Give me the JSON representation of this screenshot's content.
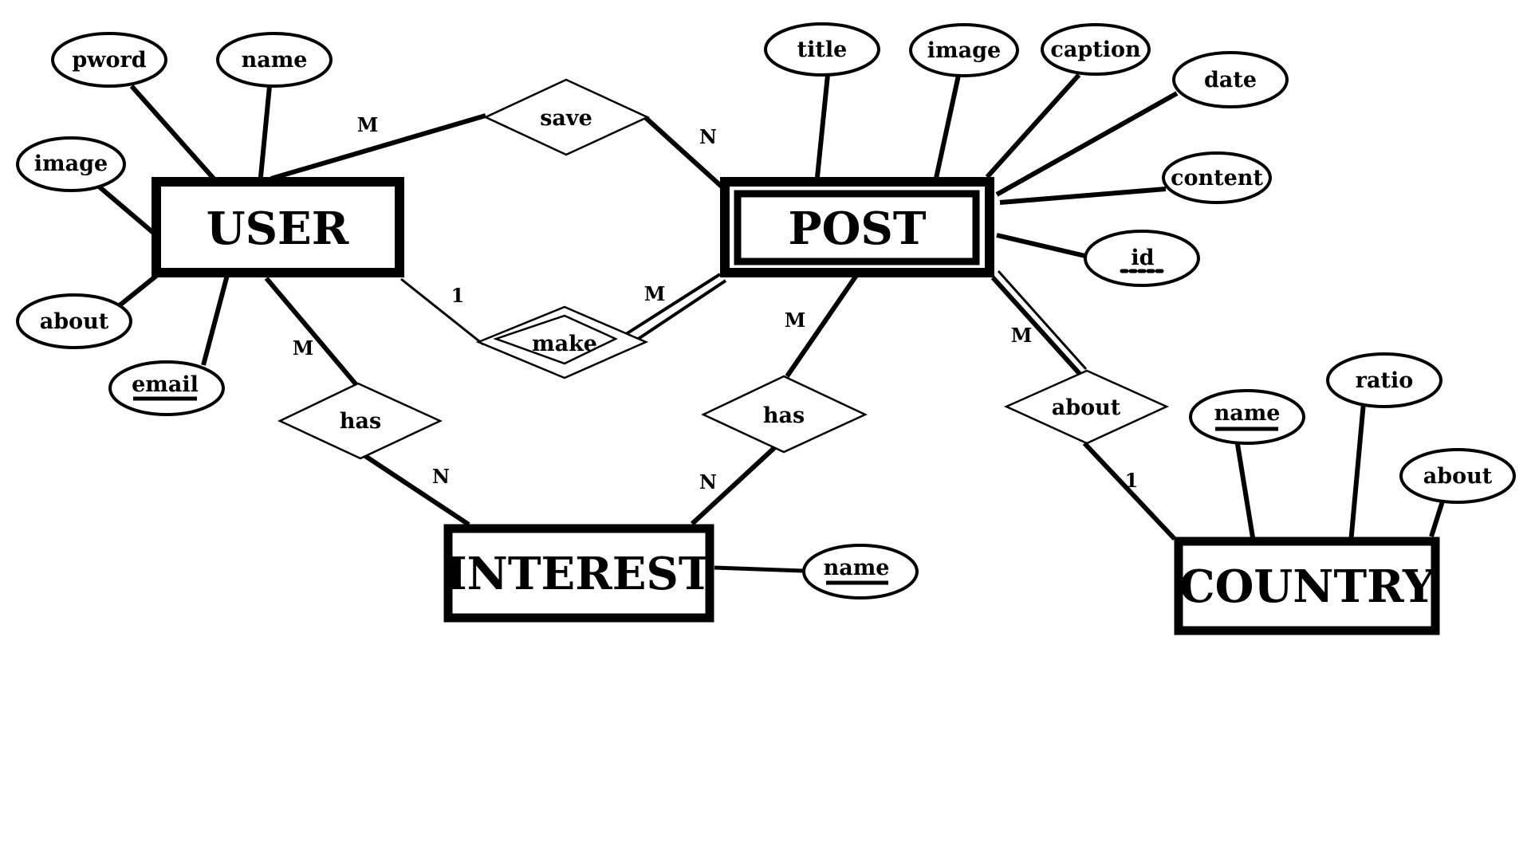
{
  "diagram": {
    "type": "ER diagram",
    "entities": {
      "user": {
        "label": "USER",
        "weak": false
      },
      "post": {
        "label": "POST",
        "weak": true
      },
      "interest": {
        "label": "INTEREST",
        "weak": false
      },
      "country": {
        "label": "COUNTRY",
        "weak": false
      }
    },
    "attributes": {
      "user_pword": {
        "label": "pword",
        "key": "none"
      },
      "user_name": {
        "label": "name",
        "key": "none"
      },
      "user_image": {
        "label": "image",
        "key": "none"
      },
      "user_about": {
        "label": "about",
        "key": "none"
      },
      "user_email": {
        "label": "email",
        "key": "primary"
      },
      "post_title": {
        "label": "title",
        "key": "none"
      },
      "post_image": {
        "label": "image",
        "key": "none"
      },
      "post_caption": {
        "label": "caption",
        "key": "none"
      },
      "post_date": {
        "label": "date",
        "key": "none"
      },
      "post_content": {
        "label": "content",
        "key": "none"
      },
      "post_id": {
        "label": "id",
        "key": "partial"
      },
      "interest_name": {
        "label": "name",
        "key": "primary"
      },
      "country_name": {
        "label": "name",
        "key": "primary"
      },
      "country_ratio": {
        "label": "ratio",
        "key": "none"
      },
      "country_about": {
        "label": "about",
        "key": "none"
      }
    },
    "relationships": {
      "save": {
        "label": "save",
        "identifying": false
      },
      "make": {
        "label": "make",
        "identifying": true
      },
      "user_has": {
        "label": "has",
        "identifying": false
      },
      "post_has": {
        "label": "has",
        "identifying": false
      },
      "about": {
        "label": "about",
        "identifying": false
      }
    },
    "cardinalities": {
      "save_user": "M",
      "save_post": "N",
      "make_user": "1",
      "make_post": "M",
      "user_has_user": "M",
      "user_has_interest": "N",
      "post_has_post": "M",
      "post_has_interest": "N",
      "about_post": "M",
      "about_country": "1"
    }
  }
}
